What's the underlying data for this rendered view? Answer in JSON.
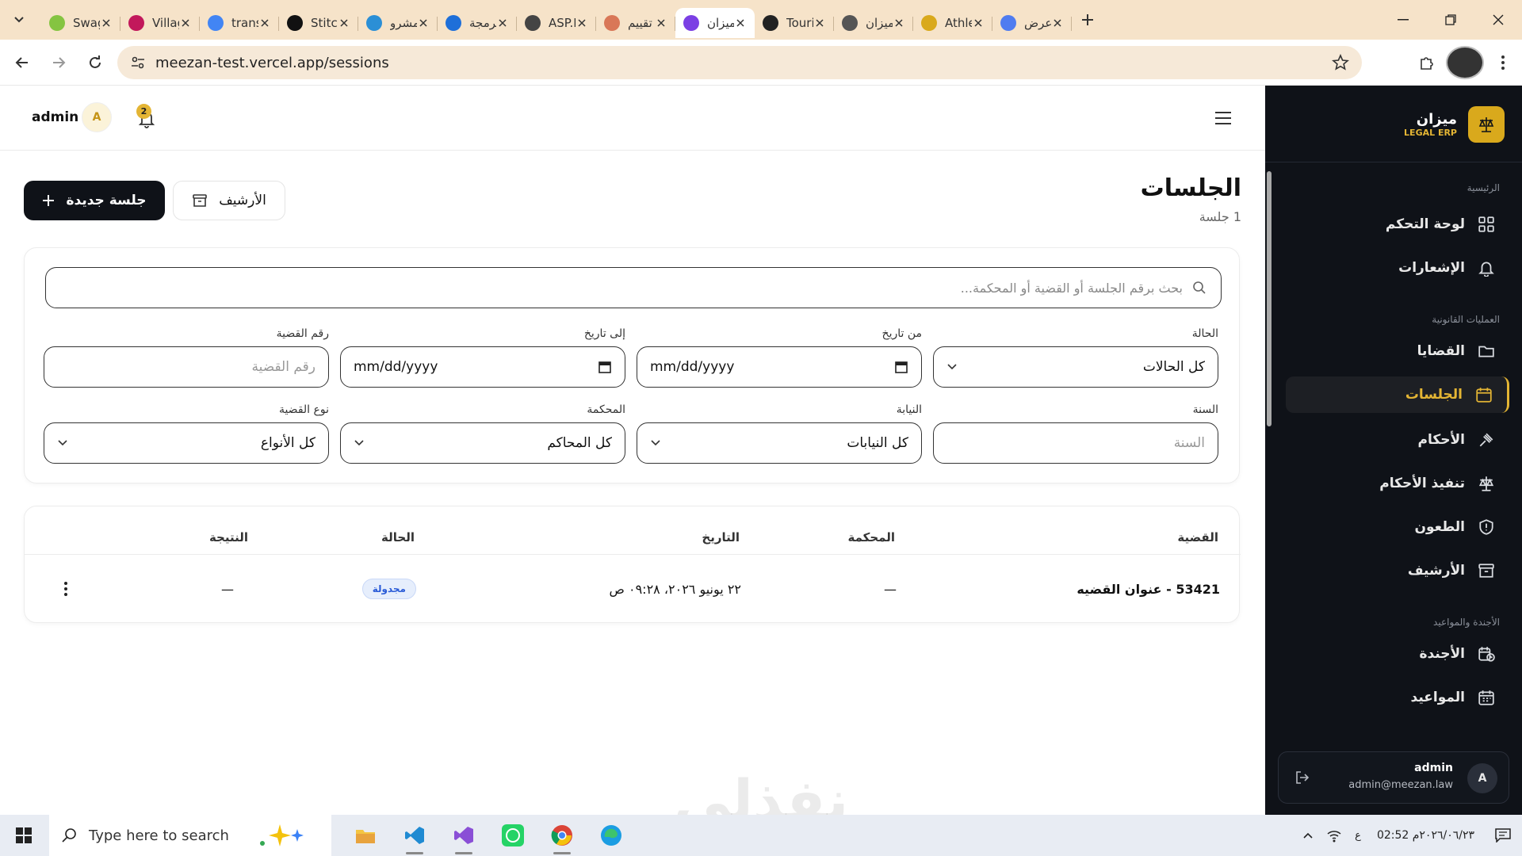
{
  "browser": {
    "tabs": [
      {
        "title": "Swag",
        "color": "#85c441",
        "icon": "swagger-icon"
      },
      {
        "title": "Villag",
        "color": "#c2185b",
        "icon": "angular-icon"
      },
      {
        "title": "trans",
        "color": "#4285f4",
        "icon": "google-icon"
      },
      {
        "title": "Stitch",
        "color": "#111111",
        "icon": "stitch-icon"
      },
      {
        "title": "مشرو",
        "color": "#2b8fd6",
        "icon": "circle-icon"
      },
      {
        "title": "برمجة",
        "color": "#1e6fd9",
        "icon": "swirl-icon"
      },
      {
        "title": "ASP.N",
        "color": "#444444",
        "icon": "openai-icon"
      },
      {
        "title": "تقييم",
        "color": "#d97757",
        "icon": "asterisk-icon"
      },
      {
        "title": "ميزان",
        "color": "#7b3fe4",
        "icon": "bolt-icon",
        "active": true
      },
      {
        "title": "Touri",
        "color": "#222222",
        "icon": "github-icon"
      },
      {
        "title": "ميزان",
        "color": "#555555",
        "icon": "globe-icon"
      },
      {
        "title": "Athle",
        "color": "#d9a91c",
        "icon": "athle-icon"
      },
      {
        "title": "عرض",
        "color": "#4f7cf0",
        "icon": "gemini-icon"
      }
    ],
    "url": "meezan-test.vercel.app/sessions"
  },
  "header": {
    "user_name": "admin",
    "user_initial": "A",
    "notif_count": "2"
  },
  "page": {
    "title": "الجلسات",
    "count": "1 جلسة",
    "new_button": "جلسة جديدة",
    "archive_button": "الأرشيف"
  },
  "filters": {
    "search_placeholder": "بحث برقم الجلسة أو القضية أو المحكمة...",
    "status_label": "الحالة",
    "status_value": "كل الحالات",
    "from_label": "من تاريخ",
    "from_value": "mm/dd/yyyy",
    "to_label": "إلى تاريخ",
    "to_value": "mm/dd/yyyy",
    "case_no_label": "رقم القضية",
    "case_no_placeholder": "رقم القضية",
    "year_label": "السنة",
    "year_placeholder": "السنة",
    "prosecution_label": "النيابة",
    "prosecution_value": "كل النيابات",
    "court_label": "المحكمة",
    "court_value": "كل المحاكم",
    "case_type_label": "نوع القضية",
    "case_type_value": "كل الأنواع"
  },
  "table": {
    "headers": {
      "case": "القضية",
      "court": "المحكمة",
      "date": "التاريخ",
      "status": "الحالة",
      "result": "النتيجة"
    },
    "rows": [
      {
        "case": "53421 - عنوان القضيه",
        "court": "—",
        "date": "٢٢ يونيو ٢٠٢٦، ٠٩:٢٨ ص",
        "status": "مجدولة",
        "result": "—"
      }
    ]
  },
  "watermark": "نفذلي",
  "sidebar": {
    "brand_name": "ميزان",
    "brand_sub": "LEGAL ERP",
    "sections": {
      "main": "الرئيسية",
      "legal": "العمليات القانونية",
      "agenda": "الأجندة والمواعيد"
    },
    "items": [
      {
        "label": "لوحة التحكم",
        "icon": "dashboard-icon"
      },
      {
        "label": "الإشعارات",
        "icon": "bell-icon"
      },
      {
        "label": "القضايا",
        "icon": "folder-icon"
      },
      {
        "label": "الجلسات",
        "icon": "calendar-icon",
        "active": true
      },
      {
        "label": "الأحكام",
        "icon": "gavel-icon"
      },
      {
        "label": "تنفيذ الأحكام",
        "icon": "scale-icon"
      },
      {
        "label": "الطعون",
        "icon": "shield-icon"
      },
      {
        "label": "الأرشيف",
        "icon": "archive-icon"
      },
      {
        "label": "الأجندة",
        "icon": "calendar-clock-icon"
      },
      {
        "label": "المواعيد",
        "icon": "calendar-grid-icon"
      }
    ],
    "user_name": "admin",
    "user_email": "admin@meezan.law",
    "user_initial": "A"
  },
  "taskbar": {
    "search_placeholder": "Type here to search",
    "time": "02:52 م",
    "date": "٢٠٢٦/٠٦/٢٣",
    "lang": "ع"
  }
}
